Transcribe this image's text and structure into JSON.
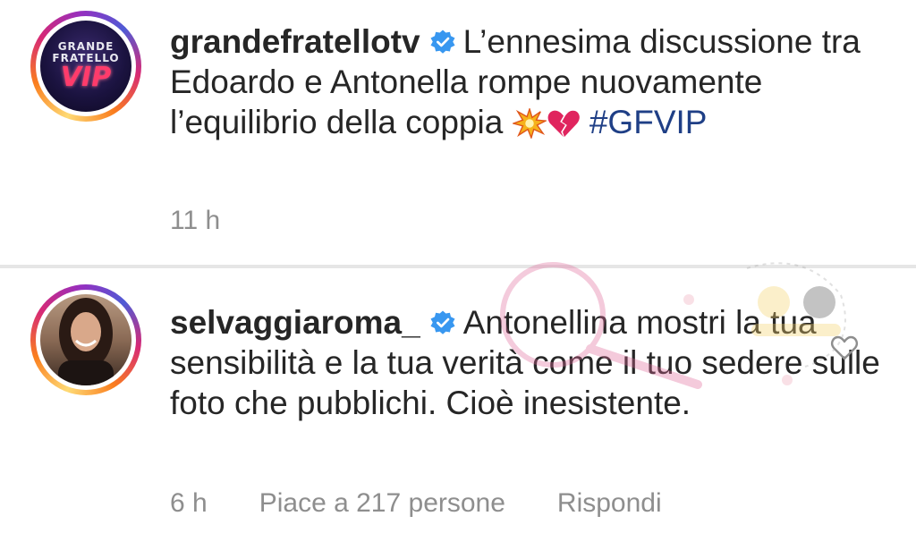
{
  "posts": [
    {
      "username": "grandefratellotv",
      "verified": true,
      "caption_pre": "L’ennesima discussione tra Edoardo e Antonella rompe nuovamente l’equilibrio della coppia",
      "emojis": [
        "collision-emoji",
        "broken-heart-emoji"
      ],
      "hashtag": "#GFVIP",
      "time": "11 h",
      "avatar": {
        "line1": "GRANDE",
        "line2": "FRATELLO",
        "line3": "VIP"
      }
    },
    {
      "username": "selvaggiaroma_",
      "verified": true,
      "comment": "Antonellina mostri la tua sensibilità e la tua verità come il tuo sedere sulle foto che pubblichi. Cioè inesistente.",
      "time": "6 h",
      "likes": "Piace a 217 persone",
      "reply": "Rispondi"
    }
  ],
  "colors": {
    "text": "#262626",
    "muted": "#8e8e8e",
    "verified": "#3897f0",
    "hashtag": "#1f3f86"
  },
  "icons": [
    "verified-badge-icon",
    "heart-outline-icon"
  ]
}
